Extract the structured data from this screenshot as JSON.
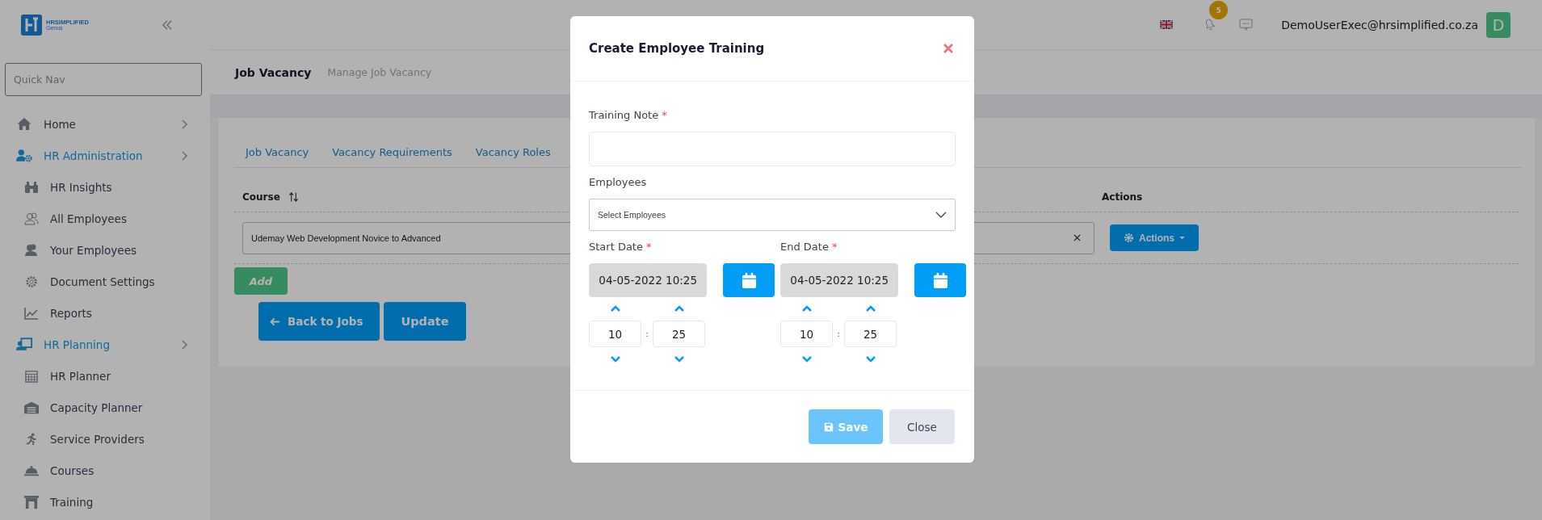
{
  "sidebar": {
    "logo": {
      "name": "HRSIMPLIFIED",
      "tagline": "Genus"
    },
    "quick_nav": {
      "placeholder": "Quick Nav"
    },
    "items": [
      {
        "label": "Home",
        "selected": false
      },
      {
        "label": "HR Administration",
        "selected": true,
        "children": [
          {
            "label": "HR Insights"
          },
          {
            "label": "All Employees"
          },
          {
            "label": "Your Employees"
          },
          {
            "label": "Document Settings"
          },
          {
            "label": "Reports"
          }
        ]
      },
      {
        "label": "HR Planning",
        "selected": true,
        "children": [
          {
            "label": "HR Planner"
          },
          {
            "label": "Capacity Planner"
          },
          {
            "label": "Service Providers"
          },
          {
            "label": "Courses"
          },
          {
            "label": "Training"
          }
        ]
      }
    ]
  },
  "top_bar": {
    "notification_count": "5",
    "user_email": "DemoUserExec@hrsimplified.co.za",
    "avatar_initial": "D"
  },
  "page_header": {
    "title": "Job Vacancy",
    "subtitle": "Manage Job Vacancy"
  },
  "tabs": [
    {
      "label": "Job Vacancy",
      "selected": false
    },
    {
      "label": "Vacancy Requirements",
      "selected": false
    },
    {
      "label": "Vacancy Roles",
      "selected": false
    }
  ],
  "table": {
    "columns": [
      "Course",
      "Actions"
    ],
    "rows": [
      {
        "course": "Udemay Web Development Novice to Advanced",
        "action": "Actions"
      }
    ]
  },
  "buttons": {
    "add": "Add",
    "back": "Back to Jobs",
    "update": "Update"
  },
  "modal": {
    "title": "Create Employee Training",
    "training_note": {
      "label": "Training Note",
      "required_mark": "*"
    },
    "employees": {
      "label": "Employees",
      "placeholder": "Select Employees"
    },
    "dates": [
      {
        "label": "Start Date",
        "required_mark": "*",
        "value": "04-05-2022 10:25",
        "hour": "10",
        "separator": ":",
        "minute": "25"
      },
      {
        "label": "End Date",
        "required_mark": "*",
        "value": "04-05-2022 10:25",
        "hour": "10",
        "separator": ":",
        "minute": "25"
      }
    ],
    "save": {
      "label": "Save",
      "disabled": true
    },
    "close": {
      "label": "Close"
    }
  }
}
